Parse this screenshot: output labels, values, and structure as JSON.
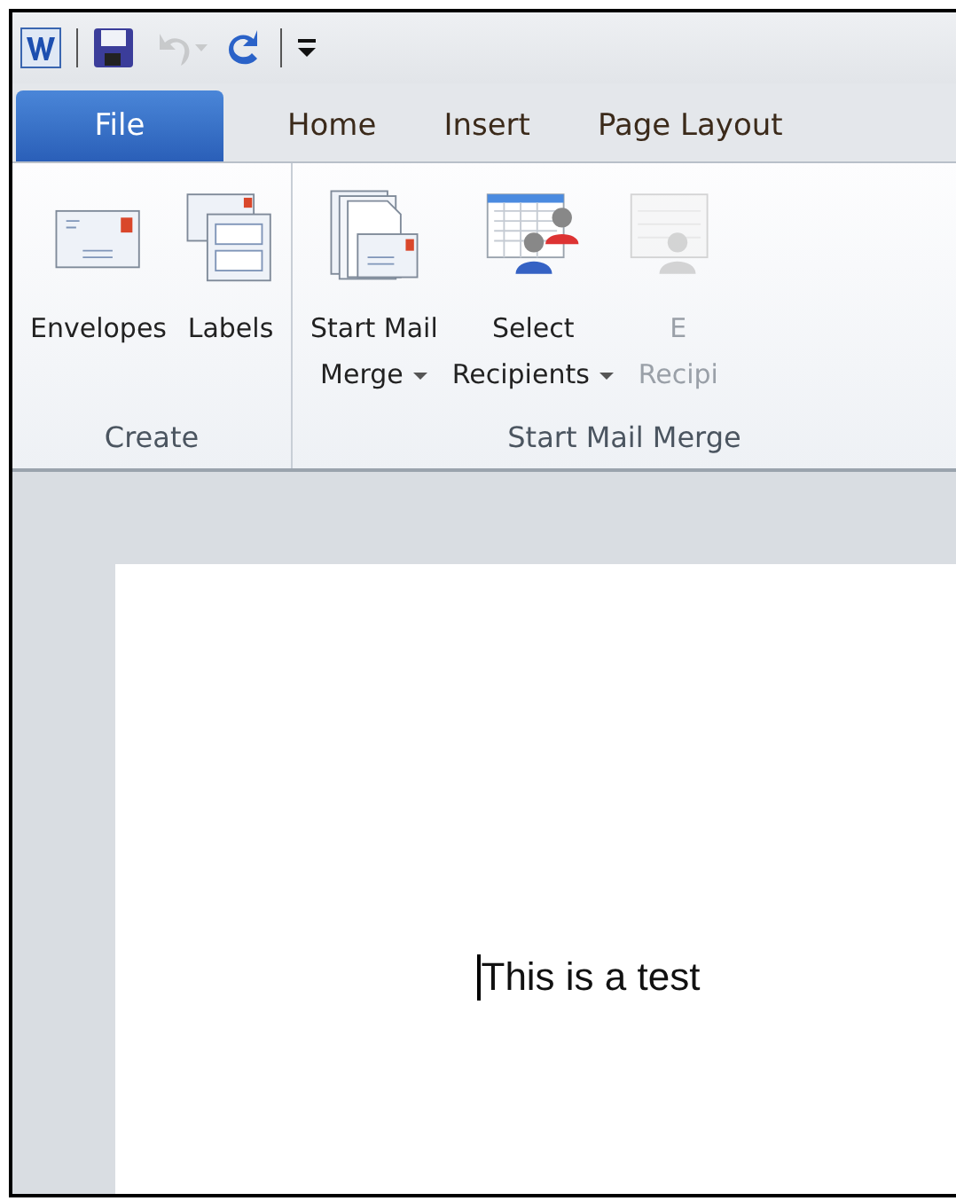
{
  "quick_access": {
    "items": [
      {
        "kind": "app"
      },
      {
        "kind": "save",
        "disabled": false
      },
      {
        "kind": "undo",
        "disabled": true
      },
      {
        "kind": "redo",
        "disabled": false
      },
      {
        "kind": "customize"
      }
    ]
  },
  "tabs": [
    {
      "label": "File",
      "selected": true
    },
    {
      "label": "Home",
      "selected": false
    },
    {
      "label": "Insert",
      "selected": false
    },
    {
      "label": "Page Layout",
      "selected": false
    }
  ],
  "ribbon": {
    "groups": [
      {
        "label": "Create",
        "buttons": [
          {
            "kind": "envelope",
            "lines": [
              "Envelopes"
            ],
            "dropdown": false,
            "disabled": false
          },
          {
            "kind": "labels",
            "lines": [
              "Labels"
            ],
            "dropdown": false,
            "disabled": false
          }
        ]
      },
      {
        "label": "Start Mail Merge",
        "buttons": [
          {
            "kind": "merge",
            "lines": [
              "Start Mail",
              "Merge"
            ],
            "dropdown": true,
            "disabled": false
          },
          {
            "kind": "recipients",
            "lines": [
              "Select",
              "Recipients"
            ],
            "dropdown": true,
            "disabled": false
          },
          {
            "kind": "edit-recipients",
            "lines": [
              "E",
              "Recipi"
            ],
            "dropdown": false,
            "disabled": true
          }
        ]
      }
    ]
  },
  "document": {
    "text": "This is a test"
  }
}
